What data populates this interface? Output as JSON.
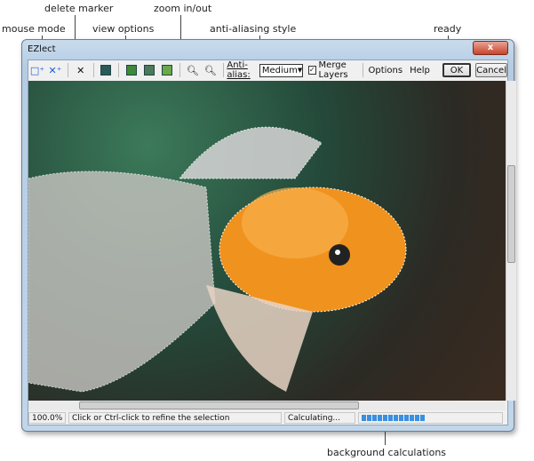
{
  "callouts": {
    "mouse_mode": "mouse mode",
    "delete_marker": "delete marker",
    "view_options": "view options",
    "zoom": "zoom in/out",
    "antialias": "anti-aliasing style",
    "ready": "ready",
    "background": "background calculations"
  },
  "window": {
    "title": "EZlect",
    "close": "x"
  },
  "toolbar": {
    "antialias_label": "Anti-alias:",
    "antialias_value": "Medium",
    "merge_layers": "Merge Layers",
    "merge_checked": true,
    "options": "Options",
    "help": "Help",
    "ok": "OK",
    "cancel": "Cancel",
    "icons": [
      "add-marker-icon",
      "add-exclude-marker-icon",
      "delete-marker-icon",
      "view-mask-icon",
      "view-image-icon",
      "view-overlay-icon",
      "view-cutout-icon",
      "zoom-in-icon",
      "zoom-out-icon"
    ]
  },
  "status": {
    "zoom": "100.0%",
    "hint": "Click or Ctrl-click to refine the selection",
    "calc": "Calculating...",
    "progress_percent": 45,
    "progress_color": "#3a8fe0"
  }
}
